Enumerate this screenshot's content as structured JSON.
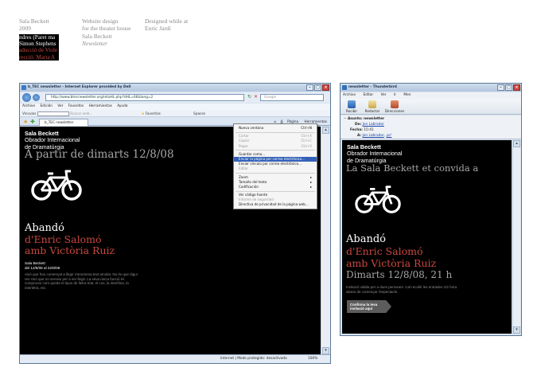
{
  "caption": {
    "col1": [
      "Sala Beckett",
      "2009"
    ],
    "col2": [
      "Website design",
      "for the theater house",
      "Sala Beckett",
      "Newsletter"
    ],
    "col3": [
      "Designed while at",
      "Enric Jardí"
    ]
  },
  "thumb": {
    "lines": [
      "ndres (Paret ma",
      "Simon Stephens",
      "aducció de Viole",
      "recció: Marta A"
    ]
  },
  "ie": {
    "title": "b_TEC newsletter - Internet Explorer provided by Dell",
    "url": "http://www.btecnewsletter.org/ietaHL.php?dHL=66&lang=2",
    "search_placeholder": "Google",
    "menu": [
      "Archivo",
      "Edición",
      "Ver",
      "Favoritos",
      "Herramientas",
      "Ayuda"
    ],
    "links": {
      "label": "Vinculos",
      "search": "Buscar web...",
      "favorites": "Favoritos",
      "spaces": "Spaces"
    },
    "tab": "b_TEC newsletter",
    "tools": {
      "page": "Página",
      "tools": "Herramientas"
    },
    "status": {
      "zone": "Internet | Modo protegido: desactivado",
      "zoom": "100%"
    },
    "context_menu": [
      {
        "label": "Nueva ventana",
        "shortcut": "Ctrl+N",
        "state": "normal"
      },
      {
        "sep": true
      },
      {
        "label": "Cortar",
        "shortcut": "Ctrl+X",
        "state": "disabled"
      },
      {
        "label": "Copiar",
        "shortcut": "Ctrl+C",
        "state": "disabled"
      },
      {
        "label": "Pegar",
        "shortcut": "Ctrl+V",
        "state": "disabled"
      },
      {
        "sep": true
      },
      {
        "label": "Guardar como...",
        "shortcut": "",
        "state": "normal"
      },
      {
        "label": "Enviar la página por correo electrónico...",
        "shortcut": "",
        "state": "highlight"
      },
      {
        "label": "Enviar vínculo por correo electrónico...",
        "shortcut": "",
        "state": "normal"
      },
      {
        "label": "Editar",
        "shortcut": "",
        "state": "disabled"
      },
      {
        "sep": true
      },
      {
        "label": "Zoom",
        "shortcut": "▸",
        "state": "normal"
      },
      {
        "label": "Tamaño del texto",
        "shortcut": "▸",
        "state": "normal"
      },
      {
        "label": "Codificación",
        "shortcut": "▸",
        "state": "normal"
      },
      {
        "sep": true
      },
      {
        "label": "Ver código fuente",
        "shortcut": "",
        "state": "normal"
      },
      {
        "label": "Informe de seguridad",
        "shortcut": "",
        "state": "disabled"
      },
      {
        "label": "Directiva de privacidad de la página web...",
        "shortcut": "",
        "state": "normal"
      }
    ],
    "newsletter": {
      "org_name": "Sala Beckett",
      "org_sub": [
        "Obrador Internacional",
        "de Dramatúrgia"
      ],
      "headline": "A partir de dimarts 12/8/08",
      "title": "Abandó",
      "author_lines": [
        "d'Enric Salomó",
        "amb Victòria Ruiz"
      ],
      "dates": [
        "Sala Beckett",
        "del 12/8/08 al 22/8/08"
      ],
      "body": [
        "Això que heu començat a llegir s'anomena text amulat. No és que digui",
        "res sinó que no serveix per a ser llegit. La seva única funció és",
        "comprovar com queda el tipus de lletra triat, el cos, la interlínia, la",
        "interletra, etc."
      ]
    }
  },
  "tb": {
    "title": "newsletter - Thunderbird",
    "menu": [
      "Archivo",
      "Editar",
      "Ver",
      "Ir",
      "Men"
    ],
    "tools": [
      "Recibir",
      "Redactar",
      "Direcciones"
    ],
    "header": {
      "subject_label": "Asunto:",
      "subject": "newsletter",
      "from_label": "De:",
      "from": "Jon Labrador",
      "date_label": "Fecha:",
      "date": "15:41",
      "to_label": "A:",
      "to": "Jon Labrador",
      "to_extra": "yo¹"
    },
    "newsletter": {
      "org_name": "Sala Beckett",
      "org_sub": [
        "Obrador Internacional",
        "de Dramatúrgia"
      ],
      "headline": "La Sala Beckett et convida a",
      "title": "Abandó",
      "author_lines": [
        "d'Enric Salomó",
        "amb Victòria Ruiz"
      ],
      "date_line": "Dimarts 12/8/08, 21 h",
      "body": [
        "Invitació vàlida per a dues persones. Cal recollir les entrades 1/2 hora",
        "abans de començar l'espectacle."
      ],
      "cta": [
        "Confirma la teva",
        "invitació aquí"
      ]
    }
  }
}
